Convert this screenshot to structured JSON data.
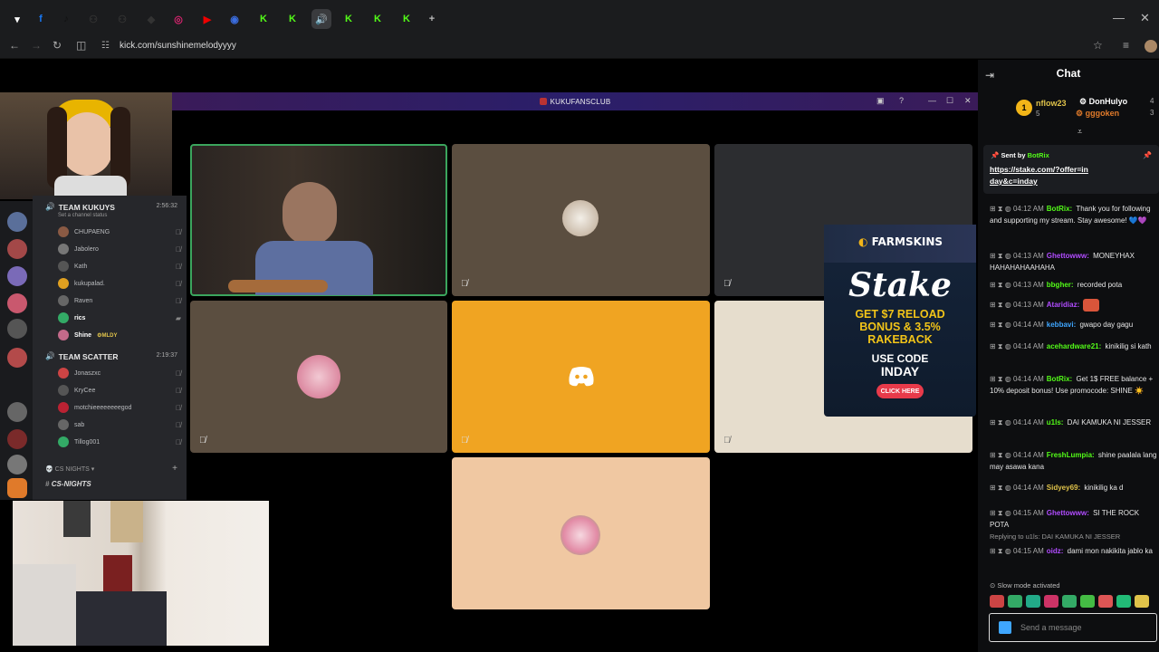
{
  "browser": {
    "url": "kick.com/sunshinemelodyyyy",
    "tabs": [
      {
        "icon": "chevron-down-icon",
        "glyph": "▾"
      },
      {
        "icon": "facebook-icon",
        "glyph": "f",
        "color": "#1877f2"
      },
      {
        "icon": "tiktok-icon",
        "glyph": "♪",
        "color": "#111"
      },
      {
        "icon": "app-icon",
        "glyph": "⚇",
        "color": "#333"
      },
      {
        "icon": "app-icon",
        "glyph": "⚇",
        "color": "#333"
      },
      {
        "icon": "diamond-icon",
        "glyph": "◆",
        "color": "#333"
      },
      {
        "icon": "instagram-icon",
        "glyph": "◎",
        "color": "#d6246e"
      },
      {
        "icon": "youtube-icon",
        "glyph": "▶",
        "color": "#e00"
      },
      {
        "icon": "globe-icon",
        "glyph": "◉",
        "color": "#3b6de0"
      },
      {
        "icon": "kick-icon",
        "glyph": "K",
        "color": "#53fc18"
      },
      {
        "icon": "kick-icon",
        "glyph": "K",
        "color": "#53fc18"
      },
      {
        "icon": "speaker-icon",
        "glyph": "🔊",
        "color": "#3a3b3e"
      },
      {
        "icon": "kick-icon",
        "glyph": "K",
        "color": "#53fc18"
      },
      {
        "icon": "kick-icon",
        "glyph": "K",
        "color": "#53fc18"
      },
      {
        "icon": "kick-icon",
        "glyph": "K",
        "color": "#53fc18"
      }
    ],
    "new_tab": "+"
  },
  "discord": {
    "title": "KUKUFANSCLUB",
    "team1": {
      "name": "TEAM KUKUYS",
      "time": "2:56:32",
      "status": "Set a channel status",
      "members": [
        "CHUPAENG",
        "Jabolero",
        "Kath",
        "kukupalad.",
        "Raven",
        "rics",
        "Shine"
      ],
      "shine_tag": "MLDY"
    },
    "team2": {
      "name": "TEAM SCATTER",
      "time": "2:19:37",
      "members": [
        "Jonaszxc",
        "KryCee",
        "motchieeeeeeeegod",
        "sab",
        "Tillog001"
      ]
    },
    "category": "CS NIGHTS",
    "channel": "CS-NIGHTS"
  },
  "ad": {
    "brand": "FARMSKINS",
    "logo": "Stake",
    "headline": "GET $7 RELOAD BONUS & 3.5% RAKEBACK",
    "use": "USE CODE",
    "code": "INDAY",
    "cta": "CLICK HERE"
  },
  "chat": {
    "title": "Chat",
    "leaders": [
      {
        "rank": "1",
        "name": "nflow23",
        "count": "5"
      },
      {
        "name": "DonHulyo",
        "count": "4"
      },
      {
        "name": "gggoken",
        "count": "3"
      }
    ],
    "pinned": {
      "sent_by": "Sent by",
      "user": "BotRix",
      "link": "https://stake.com/?offer=inday&c=inday"
    },
    "messages": [
      {
        "time": "04:12 AM",
        "user": "BotRix",
        "color": "#53fc18",
        "text": "Thank you for following and supporting my stream. Stay awesome! 💙💜"
      },
      {
        "time": "04:13 AM",
        "user": "Ghettowww",
        "color": "#b14cff",
        "text": "MONEYHAX HAHAHAHAAHAHA"
      },
      {
        "time": "04:13 AM",
        "user": "bbgher",
        "color": "#53fc18",
        "text": "recorded pota"
      },
      {
        "time": "04:13 AM",
        "user": "Ataridiaz",
        "color": "#b14cff",
        "text": ""
      },
      {
        "time": "04:14 AM",
        "user": "kebbavi",
        "color": "#3fa6ff",
        "text": "gwapo day gagu"
      },
      {
        "time": "04:14 AM",
        "user": "acehardware21",
        "color": "#53fc18",
        "text": "kinikilig si kath"
      },
      {
        "time": "04:14 AM",
        "user": "BotRix",
        "color": "#53fc18",
        "text": "Get 1$ FREE balance + 10% deposit bonus! Use promocode: SHINE ☀️"
      },
      {
        "time": "04:14 AM",
        "user": "u1ls",
        "color": "#53fc18",
        "text": "DAI KAMUKA NI JESSER"
      },
      {
        "time": "04:14 AM",
        "user": "FreshLumpia",
        "color": "#53fc18",
        "text": "shine paalala lang may asawa kana"
      },
      {
        "time": "04:14 AM",
        "user": "Sidyey69",
        "color": "#e0c34a",
        "text": "kinikilig ka d"
      },
      {
        "time": "04:15 AM",
        "user": "Ghettowww",
        "color": "#b14cff",
        "text": "SI THE ROCK POTA"
      },
      {
        "time": "04:15 AM",
        "user": "oidz",
        "color": "#b14cff",
        "text": "dami mon nakikita jablo ka"
      }
    ],
    "reply_to": "Replying to u1ls: DAI KAMUKA NI JESSER",
    "slow_mode": "Slow mode activated",
    "placeholder": "Send a message"
  }
}
